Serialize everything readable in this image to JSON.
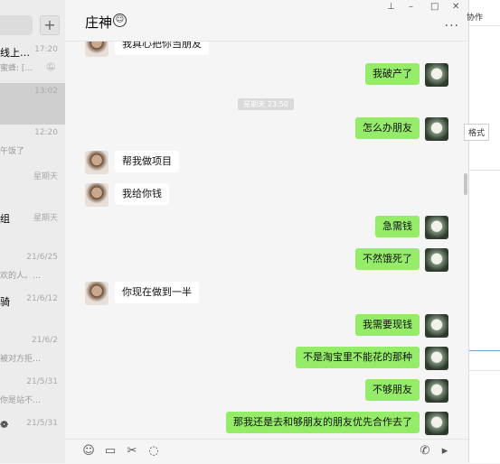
{
  "conversations": [
    {
      "name": "线上…",
      "time": "17:20",
      "preview": "蜜蜂: […",
      "muted": true,
      "selected": false
    },
    {
      "name": "",
      "time": "13:02",
      "preview": "",
      "muted": false,
      "selected": true
    },
    {
      "name": "",
      "time": "12:20",
      "preview": "午饭了",
      "muted": false,
      "selected": false
    },
    {
      "name": "",
      "time": "星期天",
      "preview": "",
      "muted": false,
      "selected": false
    },
    {
      "name": "组",
      "time": "星期天",
      "preview": "",
      "muted": false,
      "selected": false
    },
    {
      "name": "",
      "time": "21/6/25",
      "preview": "欢的人。…",
      "muted": false,
      "selected": false
    },
    {
      "name": "骑",
      "time": "21/6/12",
      "preview": "",
      "muted": false,
      "selected": false
    },
    {
      "name": "",
      "time": "21/6/2",
      "preview": "被对方拒…",
      "muted": false,
      "selected": false
    },
    {
      "name": "",
      "time": "21/5/31",
      "preview": "你是站不…",
      "muted": false,
      "selected": false
    },
    {
      "name": "❁",
      "time": "21/5/31",
      "preview": "",
      "muted": false,
      "selected": false
    }
  ],
  "chat": {
    "title": "庄神",
    "title_emoji": "☺",
    "time_separator": "星期天 23:50",
    "messages": [
      {
        "from": "other",
        "text": "我真心把你当朋友"
      },
      {
        "from": "me",
        "text": "我破产了"
      },
      {
        "from": "me",
        "text": "怎么办朋友"
      },
      {
        "from": "other",
        "text": "帮我做项目"
      },
      {
        "from": "other",
        "text": "我给你钱"
      },
      {
        "from": "me",
        "text": "急需钱"
      },
      {
        "from": "me",
        "text": "不然饿死了"
      },
      {
        "from": "other",
        "text": "你现在做到一半"
      },
      {
        "from": "me",
        "text": "我需要现钱"
      },
      {
        "from": "me",
        "text": "不是淘宝里不能花的那种"
      },
      {
        "from": "me",
        "text": "不够朋友"
      },
      {
        "from": "me",
        "text": "那我还是去和够朋友的朋友优先合作去了"
      }
    ]
  },
  "window_buttons": {
    "pin": "⊥",
    "minimize": "–",
    "maximize": "□",
    "close": "✕"
  },
  "more_menu": "···",
  "toolbar_icons": [
    "emoji-icon",
    "folder-icon",
    "scissors-icon",
    "chat-bubble-icon",
    "phone-icon",
    "video-icon"
  ],
  "right_pane": {
    "collab_label": "协作",
    "format_button": "格式"
  },
  "add_button": "+",
  "colors": {
    "my_bubble": "#95ec69",
    "other_bubble": "#ffffff",
    "chat_bg": "#f5f5f5",
    "list_bg": "#ececec"
  }
}
